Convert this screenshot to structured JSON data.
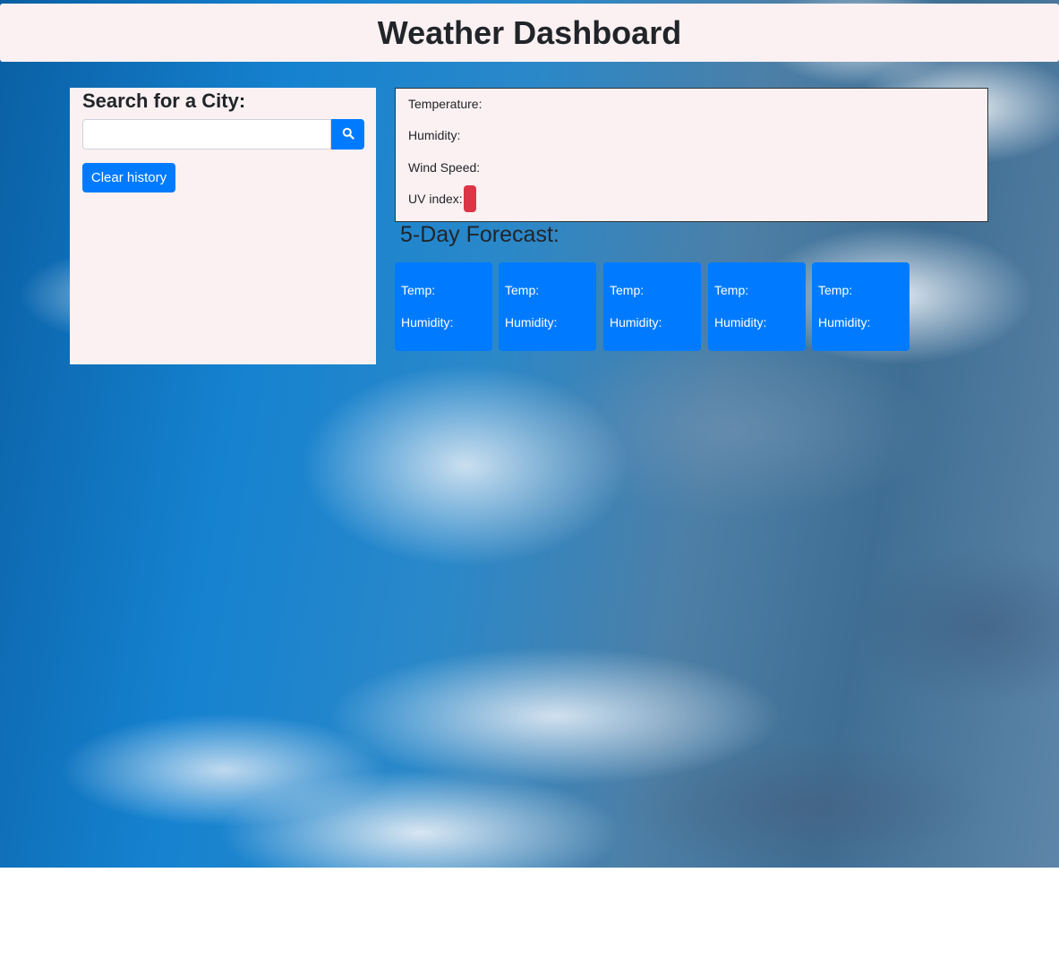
{
  "header": {
    "title": "Weather Dashboard"
  },
  "search": {
    "title": "Search for a City:",
    "input_value": "",
    "placeholder": "",
    "search_icon": "search-icon",
    "clear_label": "Clear history"
  },
  "current": {
    "temperature_label": "Temperature:",
    "humidity_label": "Humidity:",
    "wind_label": "Wind Speed:",
    "uv_label": "UV index:",
    "uv_color": "#dc3545"
  },
  "forecast": {
    "title": "5-Day Forecast:",
    "days": [
      {
        "temp_label": "Temp:",
        "humidity_label": "Humidity:"
      },
      {
        "temp_label": "Temp:",
        "humidity_label": "Humidity:"
      },
      {
        "temp_label": "Temp:",
        "humidity_label": "Humidity:"
      },
      {
        "temp_label": "Temp:",
        "humidity_label": "Humidity:"
      },
      {
        "temp_label": "Temp:",
        "humidity_label": "Humidity:"
      }
    ]
  },
  "colors": {
    "accent": "#007bff",
    "panel": "#fbf1f2",
    "danger": "#dc3545"
  }
}
